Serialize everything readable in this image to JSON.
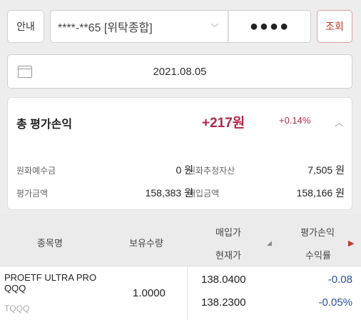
{
  "toolbar": {
    "guide_label": "안내",
    "account_label": "****-**65 [위탁종합]",
    "password_mask": "●●●●",
    "inquiry_label": "조회"
  },
  "date": {
    "value": "2021.08.05"
  },
  "summary": {
    "title": "총 평가손익",
    "amount": "+217원",
    "rate": "+0.14%",
    "deposit_label": "원화예수금",
    "deposit_value": "0 원",
    "estimated_assets_label": "원화추정자산",
    "estimated_assets_value": "7,505 원",
    "valuation_label": "평가금액",
    "valuation_value": "158,383 원",
    "purchase_label": "매입금액",
    "purchase_value": "158,166 원"
  },
  "table": {
    "headers": {
      "name": "종목명",
      "quantity": "보유수량",
      "purchase_price": "매입가",
      "current_price": "현재가",
      "pnl": "평가손익",
      "rate": "수익률"
    },
    "rows": [
      {
        "name": "PROETF ULTRA PRO QQQ",
        "code": "TQQQ",
        "quantity": "1.0000",
        "purchase_price": "138.0400",
        "current_price": "138.2300",
        "pnl": "-0.08",
        "rate": "-0.05%"
      }
    ]
  },
  "colors": {
    "positive": "#b0284a",
    "negative": "#2a4fa0",
    "accent": "#c0392b"
  },
  "icons": {
    "account_dropdown": "chevron-down-icon",
    "date": "calendar-icon",
    "collapse": "chevron-up-icon",
    "scroll": "triangle-right-icon"
  }
}
